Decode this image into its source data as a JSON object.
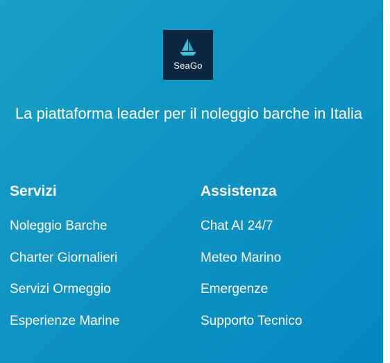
{
  "brand": {
    "name": "SeaGo",
    "logo_icon": "sailboat-icon"
  },
  "tagline": "La piattaforma leader per il noleggio barche in Italia",
  "columns": [
    {
      "heading": "Servizi",
      "links": [
        "Noleggio Barche",
        "Charter Giornalieri",
        "Servizi Ormeggio",
        "Esperienze Marine"
      ]
    },
    {
      "heading": "Assistenza",
      "links": [
        "Chat AI 24/7",
        "Meteo Marino",
        "Emergenze",
        "Supporto Tecnico"
      ]
    }
  ],
  "colors": {
    "background_gradient_start": "#1aa1c6",
    "background_gradient_end": "#0588c0",
    "logo_background": "#0d2742",
    "logo_accent": "#3fc3d6",
    "text": "#ffffff"
  }
}
